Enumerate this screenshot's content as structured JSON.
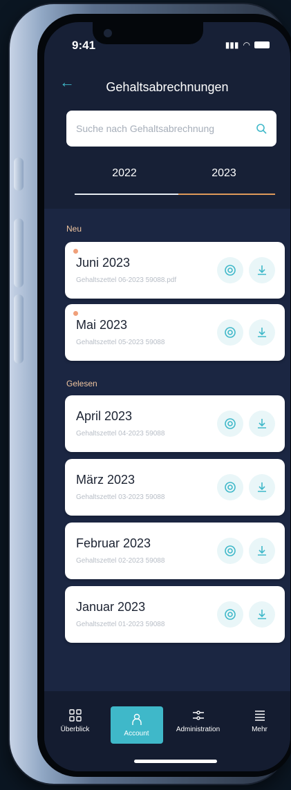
{
  "status": {
    "time": "9:41"
  },
  "header": {
    "title": "Gehaltsabrechnungen"
  },
  "search": {
    "placeholder": "Suche nach Gehaltsabrechnung"
  },
  "tabs": [
    "2022",
    "2023"
  ],
  "sections": {
    "new": "Neu",
    "read": "Gelesen"
  },
  "cards": [
    {
      "title": "Juni 2023",
      "file": "Gehaltszettel 06-2023 59088.pdf"
    },
    {
      "title": "Mai 2023",
      "file": "Gehaltszettel 05-2023 59088"
    },
    {
      "title": "April 2023",
      "file": "Gehaltszettel 04-2023 59088"
    },
    {
      "title": "März 2023",
      "file": "Gehaltszettel 03-2023 59088"
    },
    {
      "title": "Februar 2023",
      "file": "Gehaltszettel 02-2023 59088"
    },
    {
      "title": "Januar 2023",
      "file": "Gehaltszettel 01-2023 59088"
    }
  ],
  "nav": [
    {
      "label": "Überblick"
    },
    {
      "label": "Account"
    },
    {
      "label": "Administration"
    },
    {
      "label": "Mehr"
    }
  ],
  "colors": {
    "accent": "#3fb8c9",
    "tab_active": "#e09a5a",
    "new_dot": "#f0a07a",
    "background": "#172036"
  }
}
